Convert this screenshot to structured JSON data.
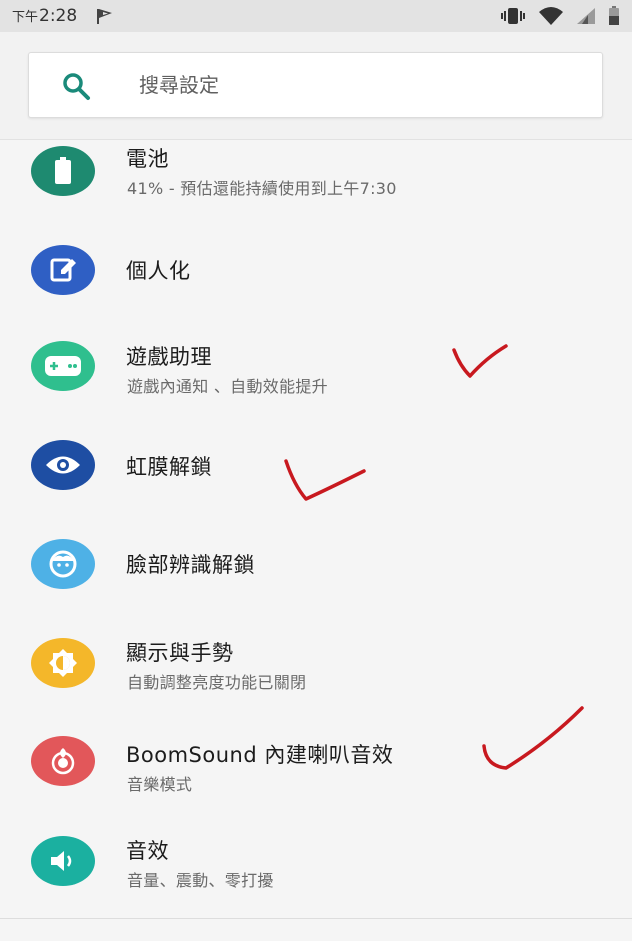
{
  "status_bar": {
    "ampm": "下午",
    "time": "2:28",
    "icons": [
      "notification-flag-icon",
      "vibrate-icon",
      "wifi-icon",
      "signal-icon",
      "battery-icon"
    ]
  },
  "search": {
    "placeholder": "搜尋設定",
    "value": ""
  },
  "colors": {
    "battery": "#1e8a70",
    "personalize": "#2f5fc4",
    "game": "#2fbf8e",
    "iris": "#1e4ea3",
    "face": "#4eb1e6",
    "display": "#f4b72a",
    "boomsound": "#e2575a",
    "sound": "#1bb0a0",
    "checkmark": "#c8191f"
  },
  "settings": [
    {
      "id": "battery",
      "icon": "battery-icon",
      "title": "電池",
      "subtitle": "41% - 預估還能持續使用到上午7:30"
    },
    {
      "id": "personalize",
      "icon": "edit-icon",
      "title": "個人化",
      "subtitle": ""
    },
    {
      "id": "game",
      "icon": "gamepad-icon",
      "title": "遊戲助理",
      "subtitle": "遊戲內通知 、自動效能提升"
    },
    {
      "id": "iris",
      "icon": "eye-icon",
      "title": "虹膜解鎖",
      "subtitle": ""
    },
    {
      "id": "face",
      "icon": "face-icon",
      "title": "臉部辨識解鎖",
      "subtitle": ""
    },
    {
      "id": "display",
      "icon": "brightness-icon",
      "title": "顯示與手勢",
      "subtitle": "自動調整亮度功能已關閉"
    },
    {
      "id": "boomsound",
      "icon": "boomsound-icon",
      "title": "BoomSound 內建喇叭音效",
      "subtitle": "音樂模式"
    },
    {
      "id": "sound",
      "icon": "speaker-icon",
      "title": "音效",
      "subtitle": "音量、震動、零打擾"
    }
  ]
}
